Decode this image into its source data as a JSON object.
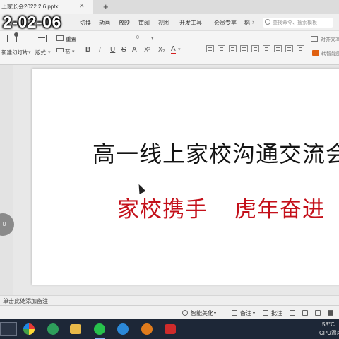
{
  "overlay": {
    "timestamp": "2-02-06"
  },
  "titlebar": {
    "doc_tab_title": "上家长会2022.2.6.pptx",
    "close_glyph": "✕",
    "new_tab_glyph": "+"
  },
  "menu": {
    "items": [
      "切换",
      "动画",
      "放映",
      "审阅",
      "视图",
      "开发工具",
      "会员专享",
      "稻"
    ],
    "more_glyph": "›",
    "search_placeholder": "查找命令、搜索模板"
  },
  "toolbar": {
    "new_slide_label": "新建幻灯片",
    "layout_label": "版式",
    "reset_label": "重置",
    "section_label": "节",
    "font_size_value": "0",
    "format_buttons": [
      "B",
      "I",
      "U",
      "S",
      "A",
      "X²",
      "X₂",
      "A"
    ],
    "text_box_label": "对齐文本",
    "smartart_label": "转智能图形",
    "arrow_glyph": "▾"
  },
  "slide": {
    "title": "高一线上家校沟通交流会",
    "subtitle_part1": "家校携手",
    "subtitle_part2": "虎年奋进"
  },
  "notes": {
    "placeholder": "单击此处添加备注"
  },
  "statusbar": {
    "smart_beautify_label": "智能美化",
    "notes_label": "备注",
    "comments_label": "批注"
  },
  "tray": {
    "temperature": "58°C",
    "cpu_label": "CPU温度"
  },
  "colors": {
    "title_text": "#141414",
    "subtitle_text": "#c4101a",
    "taskbar": "#1d2737"
  }
}
